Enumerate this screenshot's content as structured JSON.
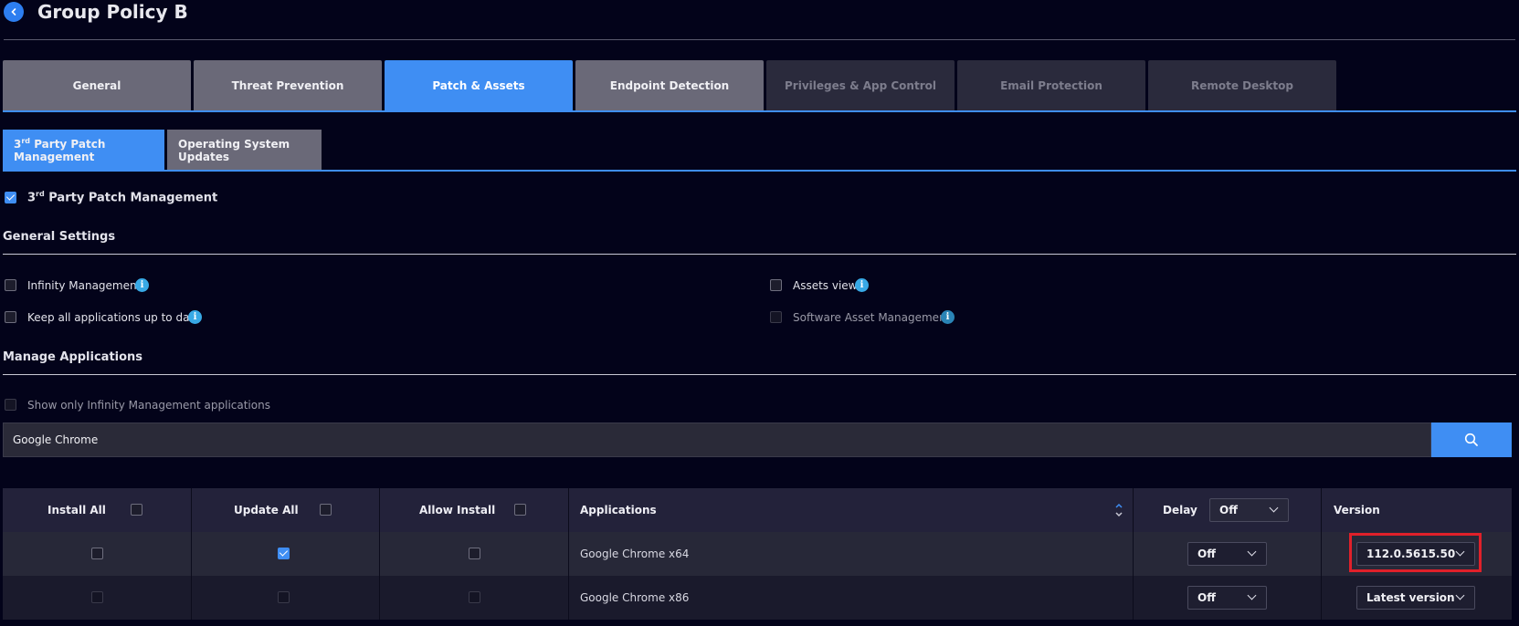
{
  "header": {
    "title": "Group Policy B"
  },
  "main_tabs": [
    {
      "label": "General",
      "state": "normal"
    },
    {
      "label": "Threat Prevention",
      "state": "normal"
    },
    {
      "label": "Patch & Assets",
      "state": "active"
    },
    {
      "label": "Endpoint Detection",
      "state": "normal"
    },
    {
      "label": "Privileges & App Control",
      "state": "dim"
    },
    {
      "label": "Email Protection",
      "state": "dim"
    },
    {
      "label": "Remote Desktop",
      "state": "dim"
    }
  ],
  "sub_tabs": {
    "third_party_prefix": "3",
    "third_party_sup": "rd",
    "third_party_rest": " Party Patch Management",
    "os_updates": "Operating System Updates"
  },
  "patch_toggle": {
    "prefix": "3",
    "sup": "rd",
    "rest": " Party Patch Management",
    "checked": true
  },
  "general_settings": {
    "title": "General Settings",
    "infinity_management": "Infinity Management",
    "keep_up_to_date": "Keep all applications up to date",
    "assets_view": "Assets view",
    "software_asset_management": "Software Asset Management",
    "info_glyph": "i"
  },
  "manage_apps": {
    "title": "Manage Applications",
    "show_only_infinity": "Show only Infinity Management applications",
    "search_value": "Google Chrome"
  },
  "table": {
    "headers": {
      "install_all": "Install All",
      "update_all": "Update All",
      "allow_install": "Allow Install",
      "applications": "Applications",
      "delay": "Delay",
      "delay_value": "Off",
      "version": "Version"
    },
    "rows": [
      {
        "install": false,
        "update": true,
        "allow": false,
        "app": "Google Chrome x64",
        "delay": "Off",
        "version": "112.0.5615.50"
      },
      {
        "install": false,
        "update": false,
        "allow": false,
        "app": "Google Chrome x86",
        "delay": "Off",
        "version": "Latest version"
      }
    ]
  },
  "colors": {
    "accent": "#3f8ef3",
    "highlight": "#e0202a",
    "background": "#03031a"
  }
}
